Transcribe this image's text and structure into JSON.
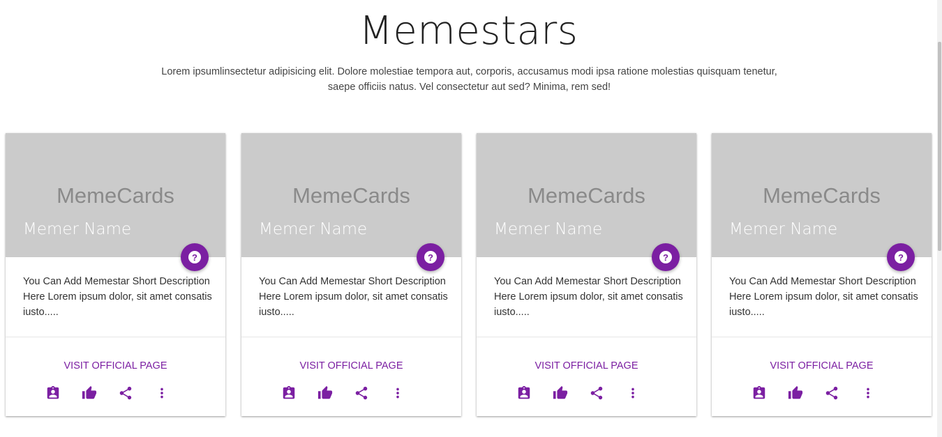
{
  "header": {
    "title": "Memestars",
    "description": "Lorem ipsumlinsectetur adipisicing elit. Dolore molestiae tempora aut, corporis, accusamus modi ipsa ratione molestias quisquam tenetur, saepe officiis natus. Vel consectetur aut sed? Minima, rem sed!"
  },
  "theme": {
    "accent": "#7b1fa2",
    "media_bg": "#cbcbcb"
  },
  "cards": [
    {
      "media_text": "MemeCards",
      "name": "Memer Name",
      "description": "You Can Add Memestar Short Description Here Lorem ipsum dolor, sit amet consatis iusto.....",
      "link": "VISIT OFFICIAL PAGE",
      "fab_icon": "help-icon",
      "action_icons": [
        "contact-badge-icon",
        "thumb-up-icon",
        "share-icon",
        "more-vert-icon"
      ]
    },
    {
      "media_text": "MemeCards",
      "name": "Memer Name",
      "description": "You Can Add Memestar Short Description Here Lorem ipsum dolor, sit amet consatis iusto.....",
      "link": "VISIT OFFICIAL PAGE",
      "fab_icon": "help-icon",
      "action_icons": [
        "contact-badge-icon",
        "thumb-up-icon",
        "share-icon",
        "more-vert-icon"
      ]
    },
    {
      "media_text": "MemeCards",
      "name": "Memer Name",
      "description": "You Can Add Memestar Short Description Here Lorem ipsum dolor, sit amet consatis iusto.....",
      "link": "VISIT OFFICIAL PAGE",
      "fab_icon": "help-icon",
      "action_icons": [
        "contact-badge-icon",
        "thumb-up-icon",
        "share-icon",
        "more-vert-icon"
      ]
    },
    {
      "media_text": "MemeCards",
      "name": "Memer Name",
      "description": "You Can Add Memestar Short Description Here Lorem ipsum dolor, sit amet consatis iusto.....",
      "link": "VISIT OFFICIAL PAGE",
      "fab_icon": "help-icon",
      "action_icons": [
        "contact-badge-icon",
        "thumb-up-icon",
        "share-icon",
        "more-vert-icon"
      ]
    }
  ]
}
